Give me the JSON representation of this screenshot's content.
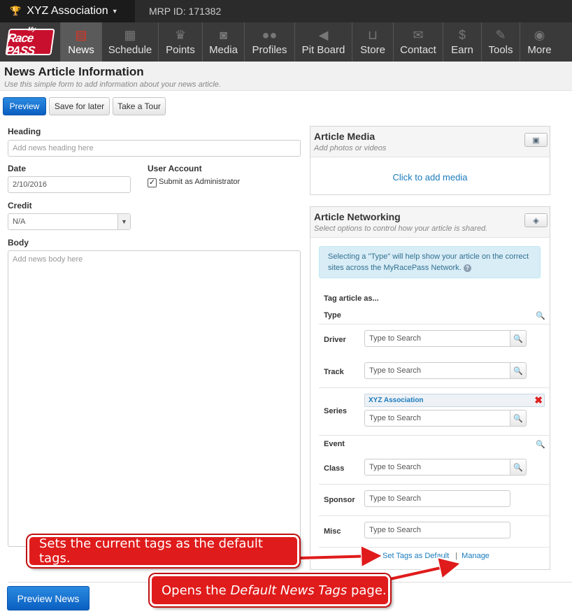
{
  "topbar": {
    "org_name": "XYZ Association",
    "mrp_id": "MRP ID: 171382"
  },
  "logo": {
    "top": "My",
    "bottom": "Race PASS"
  },
  "nav": [
    {
      "label": "News",
      "icon": "newspaper-icon",
      "active": true
    },
    {
      "label": "Schedule",
      "icon": "calendar-icon"
    },
    {
      "label": "Points",
      "icon": "trophy-icon"
    },
    {
      "label": "Media",
      "icon": "camera-icon"
    },
    {
      "label": "Profiles",
      "icon": "users-icon"
    },
    {
      "label": "Pit Board",
      "icon": "megaphone-icon"
    },
    {
      "label": "Store",
      "icon": "cart-icon"
    },
    {
      "label": "Contact",
      "icon": "envelope-icon"
    },
    {
      "label": "Earn",
      "icon": "dollar-icon"
    },
    {
      "label": "Tools",
      "icon": "wrench-icon"
    },
    {
      "label": "More",
      "icon": "chevron-circle-icon"
    }
  ],
  "page": {
    "title": "News Article Information",
    "subtitle": "Use this simple form to add information about your news article."
  },
  "toolbar": {
    "preview": "Preview",
    "save_later": "Save for later",
    "tour": "Take a Tour"
  },
  "form": {
    "heading_label": "Heading",
    "heading_placeholder": "Add news heading here",
    "date_label": "Date",
    "date_value": "2/10/2016",
    "user_account_label": "User Account",
    "submit_admin_label": "Submit as Administrator",
    "submit_admin_checked": true,
    "credit_label": "Credit",
    "credit_value": "N/A",
    "body_label": "Body",
    "body_placeholder": "Add news body here",
    "preview_news": "Preview News"
  },
  "media_panel": {
    "title": "Article Media",
    "subtitle": "Add photos or videos",
    "add_link": "Click to add media"
  },
  "networking_panel": {
    "title": "Article Networking",
    "subtitle": "Select options to control how your article is shared.",
    "info": "Selecting a \"Type\" will help show your article on the correct sites across the MyRacePass Network.",
    "tag_heading": "Tag article as...",
    "type_label": "Type",
    "driver_label": "Driver",
    "track_label": "Track",
    "series_label": "Series",
    "series_token": "XYZ Association",
    "event_label": "Event",
    "class_label": "Class",
    "sponsor_label": "Sponsor",
    "misc_label": "Misc",
    "search_placeholder": "Type to Search",
    "set_default": "Set Tags as Default",
    "separator": "|",
    "manage": "Manage"
  },
  "callouts": {
    "set_default": "Sets the current tags as the default tags.",
    "manage_prefix": "Opens the ",
    "manage_italic": "Default News Tags",
    "manage_suffix": " page."
  },
  "colors": {
    "primary_button": "#0a5fc1",
    "callout_red": "#e01b1b",
    "link_blue": "#1a7bbd",
    "info_bg": "#d9edf7"
  }
}
